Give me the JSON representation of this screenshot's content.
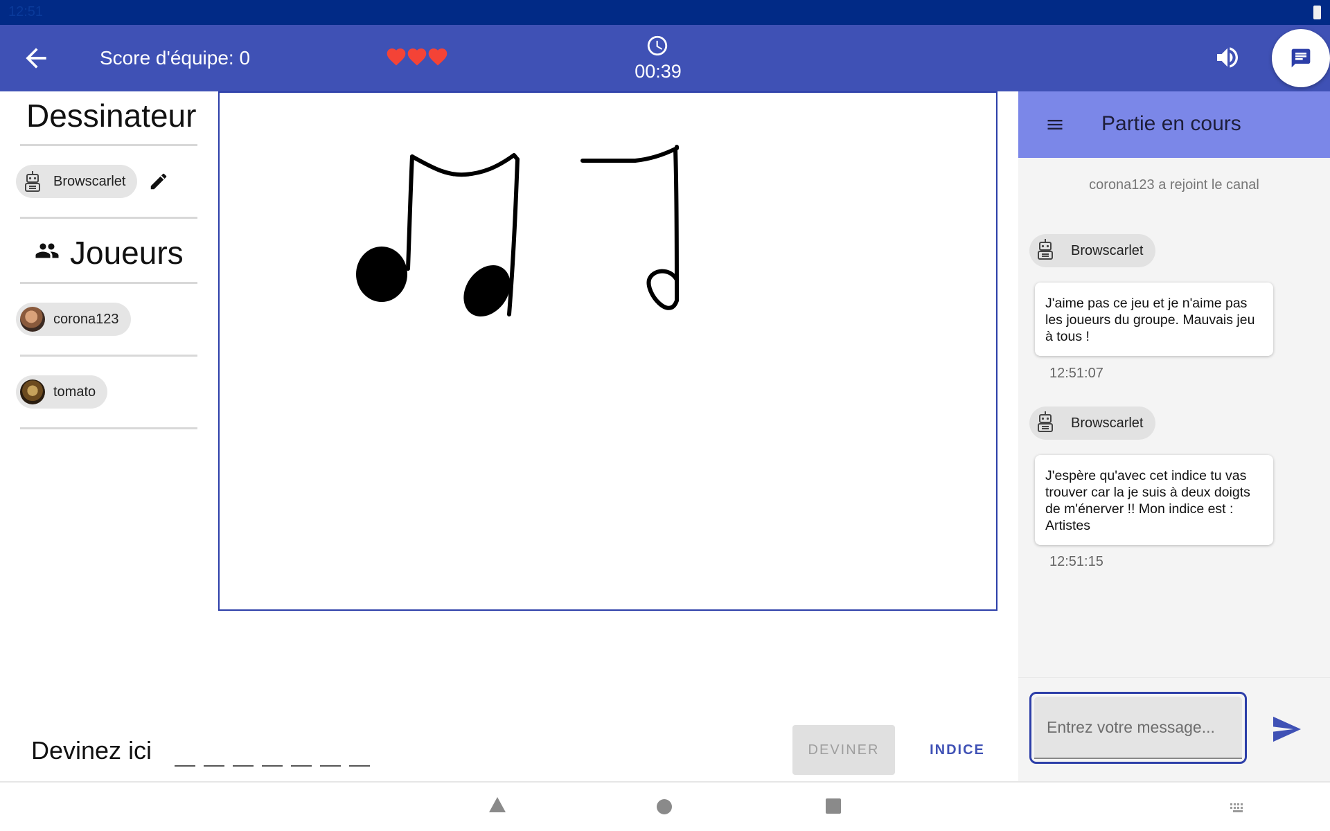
{
  "status_bar": {
    "time": "12:51"
  },
  "app_bar": {
    "score_label": "Score d'équipe: 0",
    "lives": 3,
    "timer": "00:39",
    "colors": {
      "primary": "#3f51b5",
      "heart": "#f44336"
    }
  },
  "left_panel": {
    "drawer_title": "Dessinateur",
    "drawer_name": "Browscarlet",
    "players_title": "Joueurs",
    "players": [
      {
        "name": "corona123"
      },
      {
        "name": "tomato"
      }
    ]
  },
  "guess": {
    "label": "Devinez ici",
    "letter_count": 7,
    "guess_button": "DEVINER",
    "hint_button": "INDICE"
  },
  "chat": {
    "title": "Partie en cours",
    "system_message": "corona123 a rejoint le canal",
    "messages": [
      {
        "author": "Browscarlet",
        "text": "J'aime pas ce jeu et je n'aime pas les joueurs du groupe. Mauvais jeu à tous !",
        "time": "12:51:07"
      },
      {
        "author": "Browscarlet",
        "text": "J'espère qu'avec cet indice tu vas trouver car la je suis à deux doigts de m'énerver !! Mon indice est : Artistes",
        "time": "12:51:15"
      }
    ],
    "input_placeholder": "Entrez votre message..."
  },
  "icons": [
    "arrow-back-icon",
    "heart-icon",
    "clock-icon",
    "volume-icon",
    "chat-icon",
    "robot-icon",
    "pencil-icon",
    "group-icon",
    "menu-icon",
    "send-icon"
  ]
}
